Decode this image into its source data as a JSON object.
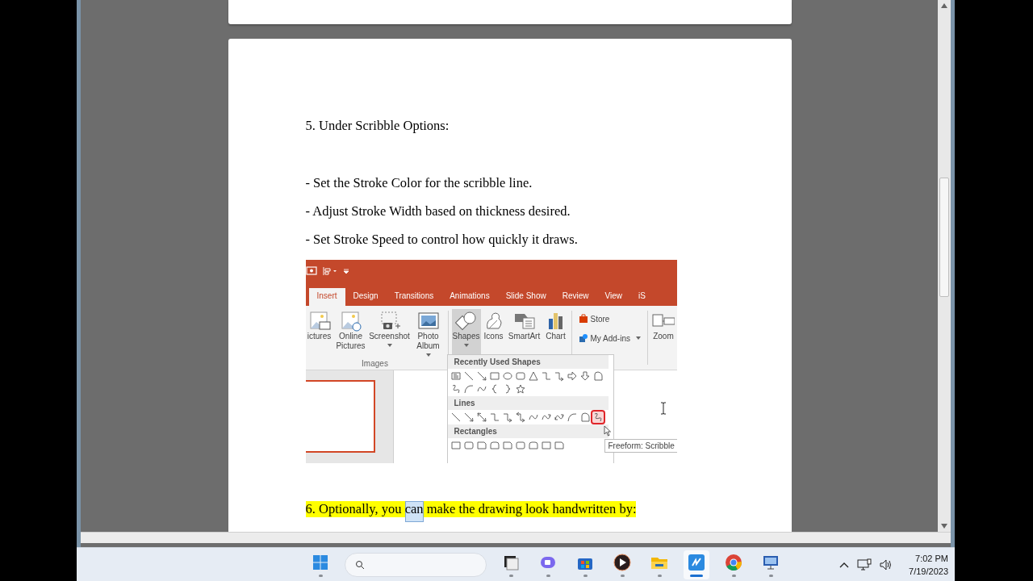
{
  "document": {
    "paragraphs": [
      {
        "text": "5. Under Scribble Options:"
      },
      {
        "text": "- Set the Stroke Color for the scribble line."
      },
      {
        "text": "- Adjust Stroke Width based on thickness desired."
      },
      {
        "text": "- Set Stroke Speed to control how quickly it draws."
      }
    ],
    "screenshot": {
      "tabs": [
        {
          "label": "Insert",
          "selected": true
        },
        {
          "label": "Design",
          "selected": false
        },
        {
          "label": "Transitions",
          "selected": false
        },
        {
          "label": "Animations",
          "selected": false
        },
        {
          "label": "Slide Show",
          "selected": false
        },
        {
          "label": "Review",
          "selected": false
        },
        {
          "label": "View",
          "selected": false
        },
        {
          "label": "iS",
          "selected": false
        }
      ],
      "image_buttons": [
        {
          "label": "ictures",
          "kind": "pictures",
          "dropdown": false
        },
        {
          "label": "Online Pictures",
          "kind": "online",
          "dropdown": false
        },
        {
          "label": "Screenshot",
          "kind": "screenshot",
          "dropdown": true
        },
        {
          "label": "Photo Album",
          "kind": "album",
          "dropdown": true
        }
      ],
      "images_group_label": "Images",
      "illustration_buttons": [
        {
          "label": "Shapes",
          "kind": "shapes",
          "selected": true,
          "dropdown": true
        },
        {
          "label": "Icons",
          "kind": "icons",
          "selected": false,
          "dropdown": false
        },
        {
          "label": "SmartArt",
          "kind": "smartart",
          "selected": false,
          "dropdown": false
        },
        {
          "label": "Chart",
          "kind": "chart",
          "selected": false,
          "dropdown": false
        }
      ],
      "addin_buttons": [
        {
          "label": "Store",
          "kind": "store",
          "dropdown": false
        },
        {
          "label": "My Add-ins",
          "kind": "addins",
          "dropdown": true
        }
      ],
      "zoom_button": {
        "label": "Zoom"
      },
      "shapes_menu": [
        {
          "title": "Recently Used Shapes",
          "shapes": [
            {
              "kind": "textbox",
              "selected": false
            },
            {
              "kind": "line",
              "selected": false
            },
            {
              "kind": "arrow",
              "selected": false
            },
            {
              "kind": "rect",
              "selected": false
            },
            {
              "kind": "oval",
              "selected": false
            },
            {
              "kind": "roundrect",
              "selected": false
            },
            {
              "kind": "triangle",
              "selected": false
            },
            {
              "kind": "elbow",
              "selected": false
            },
            {
              "kind": "elbow-arrow",
              "selected": false
            },
            {
              "kind": "right-arrow",
              "selected": false
            },
            {
              "kind": "down-arrow",
              "selected": false
            },
            {
              "kind": "freeform",
              "selected": false
            },
            {
              "kind": "scribble",
              "selected": false
            },
            {
              "kind": "arc",
              "selected": false
            },
            {
              "kind": "curve",
              "selected": false
            },
            {
              "kind": "brace-left",
              "selected": false
            },
            {
              "kind": "brace-right",
              "selected": false
            },
            {
              "kind": "star",
              "selected": false
            }
          ]
        },
        {
          "title": "Lines",
          "shapes": [
            {
              "kind": "line",
              "selected": false
            },
            {
              "kind": "arrow",
              "selected": false
            },
            {
              "kind": "double-arrow",
              "selected": false
            },
            {
              "kind": "elbow",
              "selected": false
            },
            {
              "kind": "elbow-arrow",
              "selected": false
            },
            {
              "kind": "elbow-double",
              "selected": false
            },
            {
              "kind": "curve",
              "selected": false
            },
            {
              "kind": "curve-arrow",
              "selected": false
            },
            {
              "kind": "curve-double",
              "selected": false
            },
            {
              "kind": "arc",
              "selected": false
            },
            {
              "kind": "freeform",
              "selected": false
            },
            {
              "kind": "scribble",
              "selected": true
            }
          ]
        },
        {
          "title": "Rectangles",
          "shapes": [
            {
              "kind": "rect",
              "selected": false
            },
            {
              "kind": "roundrect",
              "selected": false
            },
            {
              "kind": "snip-rect",
              "selected": false
            },
            {
              "kind": "round-top",
              "selected": false
            },
            {
              "kind": "snip-rect",
              "selected": false
            },
            {
              "kind": "roundrect",
              "selected": false
            },
            {
              "kind": "round-top",
              "selected": false
            },
            {
              "kind": "rect",
              "selected": false
            },
            {
              "kind": "snip-rect",
              "selected": false
            }
          ]
        }
      ],
      "tooltip": "Freeform: Scribble"
    },
    "last_paragraph": {
      "highlight": true,
      "parts": [
        {
          "text": "6. Optionally, you ",
          "selected": false
        },
        {
          "text": "can",
          "selected": true
        },
        {
          "text": " make the drawing look handwritten by:",
          "selected": false
        }
      ]
    }
  },
  "taskbar": {
    "apps": [
      {
        "kind": "start",
        "selected": false
      },
      {
        "kind": "search",
        "selected": false
      },
      {
        "kind": "taskview",
        "selected": false
      },
      {
        "kind": "chat",
        "selected": false
      },
      {
        "kind": "store",
        "selected": false
      },
      {
        "kind": "media",
        "selected": false
      },
      {
        "kind": "explorer",
        "selected": false
      },
      {
        "kind": "whiteboard",
        "selected": true
      },
      {
        "kind": "chrome",
        "selected": false
      },
      {
        "kind": "remote",
        "selected": false
      }
    ],
    "time": "7:02 PM",
    "date": "7/19/2023"
  }
}
